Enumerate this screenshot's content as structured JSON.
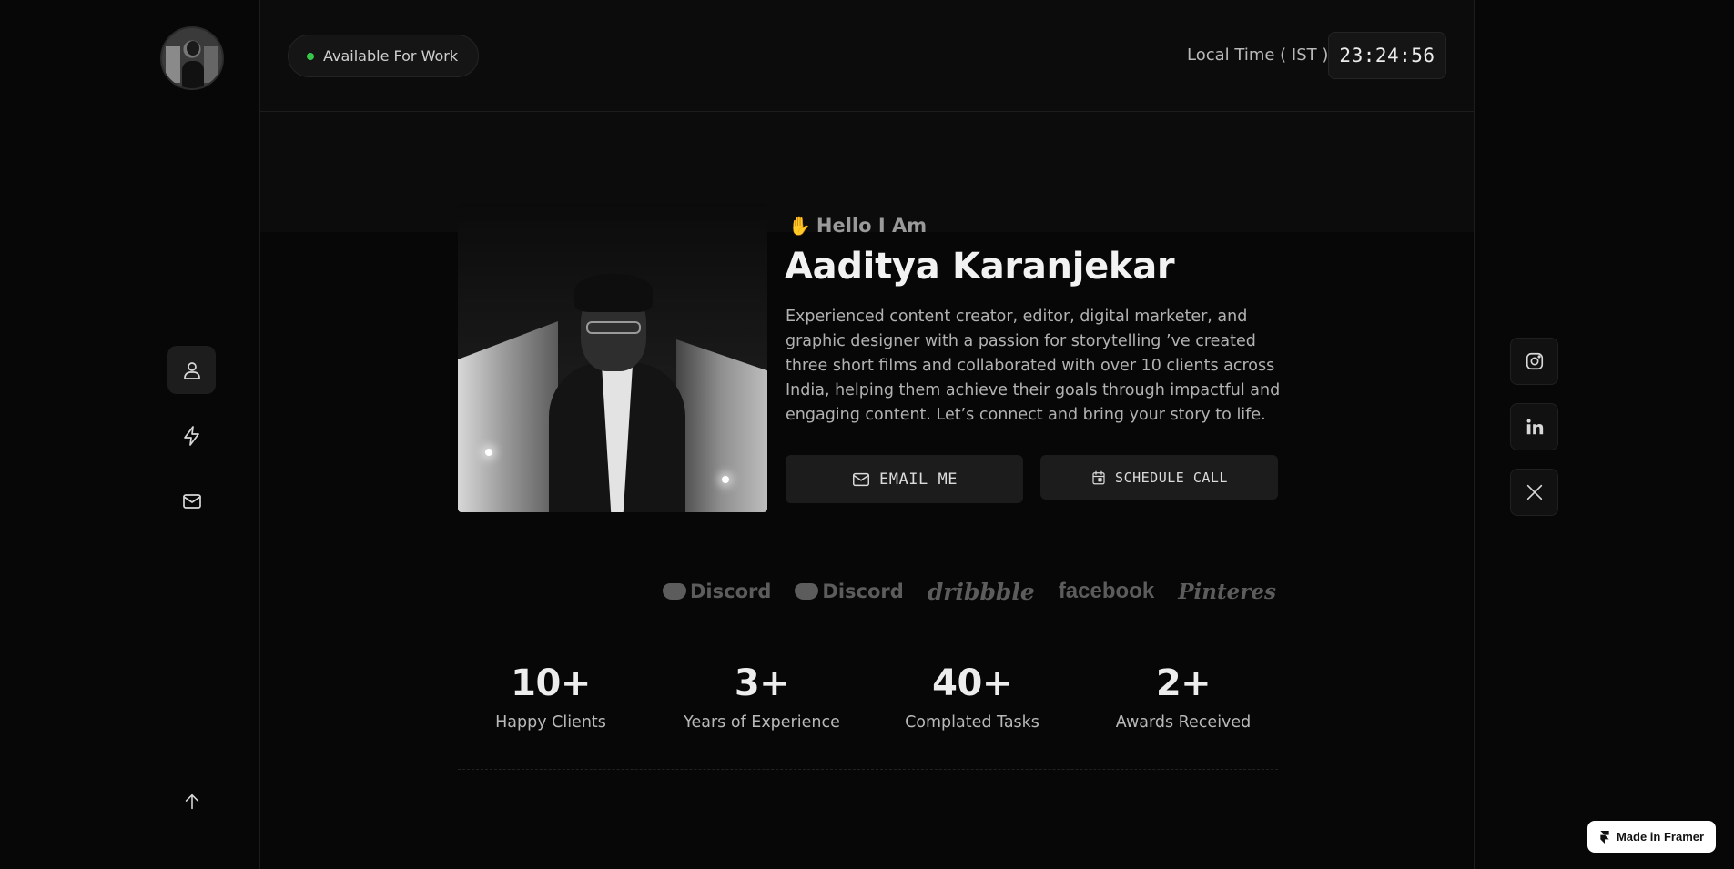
{
  "header": {
    "status": "Available For Work",
    "time_label": "Local Time ( IST )",
    "time_value": "23:24:56"
  },
  "nav": {
    "items": [
      {
        "icon": "user-icon",
        "active": true
      },
      {
        "icon": "lightning-icon",
        "active": false
      },
      {
        "icon": "mail-icon",
        "active": false
      }
    ],
    "scroll_top_icon": "arrow-up-icon"
  },
  "hero": {
    "greeting": "Hello I Am",
    "greeting_emoji": "✋",
    "name": "Aaditya Karanjekar",
    "bio": "Experienced content creator, editor, digital marketer, and graphic designer with a passion for storytelling ’ve created three short films and collaborated with over 10 clients across India, helping them achieve their goals through impactful and engaging content. Let’s connect and bring your story to life.",
    "email_button": "EMAIL ME",
    "schedule_button": "SCHEDULE CALL"
  },
  "logos": [
    "Discord",
    "Discord",
    "dribbble",
    "facebook",
    "Pinterest"
  ],
  "stats": [
    {
      "value": "10+",
      "label": "Happy Clients"
    },
    {
      "value": "3+",
      "label": "Years of Experience"
    },
    {
      "value": "40+",
      "label": "Complated Tasks"
    },
    {
      "value": "2+",
      "label": "Awards Received"
    }
  ],
  "socials": [
    "instagram-icon",
    "linkedin-icon",
    "x-icon"
  ],
  "badge": {
    "label": "Made in Framer"
  },
  "colors": {
    "status_dot": "#37c64a",
    "background": "#070707",
    "panel": "#1c1c1c"
  }
}
